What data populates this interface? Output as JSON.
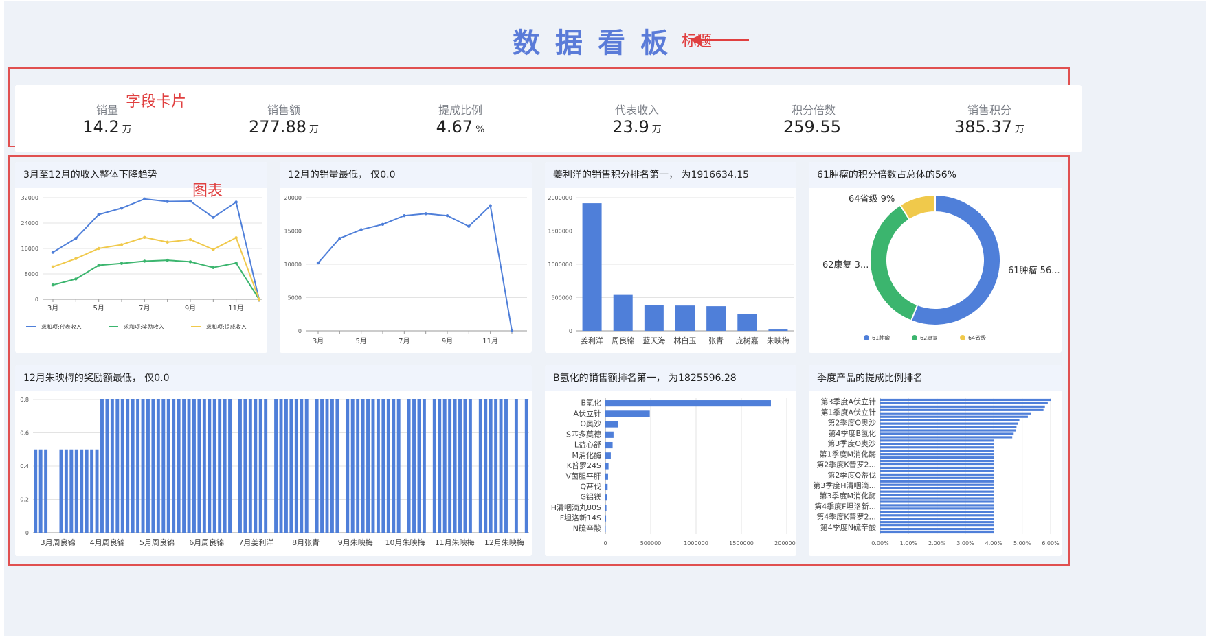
{
  "title": "数据看板",
  "annotations": {
    "title_label": "标题",
    "cards_label": "字段卡片",
    "charts_label": "图表"
  },
  "colors": {
    "accent": "#5a7bd8",
    "blue": "#4f7fd9",
    "green": "#3bb56e",
    "yellow": "#f0c94b",
    "annot": "#e04040"
  },
  "cards": [
    {
      "label": "销量",
      "value": "14.2",
      "unit": "万"
    },
    {
      "label": "销售额",
      "value": "277.88",
      "unit": "万"
    },
    {
      "label": "提成比例",
      "value": "4.67",
      "unit": "%"
    },
    {
      "label": "代表收入",
      "value": "23.9",
      "unit": "万"
    },
    {
      "label": "积分倍数",
      "value": "259.55",
      "unit": ""
    },
    {
      "label": "销售积分",
      "value": "385.37",
      "unit": "万"
    }
  ],
  "panels": {
    "p1": "3月至12月的收入整体下降趋势",
    "p2": "12月的销量最低， 仅0.0",
    "p3": "姜利洋的销售积分排名第一， 为1916634.15",
    "p4": "61肿瘤的积分倍数占总体的56%",
    "p5": "12月朱映梅的奖励额最低， 仅0.0",
    "p6": "B氢化的销售额排名第一， 为1825596.28",
    "p7": "季度产品的提成比例排名"
  },
  "chart_data": [
    {
      "type": "line",
      "x": [
        "3月",
        "4月",
        "5月",
        "6月",
        "7月",
        "8月",
        "9月",
        "10月",
        "11月",
        "12月"
      ],
      "x_ticks": [
        "3月",
        "5月",
        "7月",
        "9月",
        "11月"
      ],
      "ylim": [
        0,
        32000
      ],
      "y_ticks": [
        "0",
        "8000",
        "16000",
        "24000",
        "32000"
      ],
      "series": [
        {
          "name": "求和项:代表收入",
          "color": "#4f7fd9",
          "values": [
            14800,
            19200,
            26700,
            28700,
            31600,
            30800,
            30900,
            25800,
            30600,
            0
          ]
        },
        {
          "name": "求和项:奖励收入",
          "color": "#3bb56e",
          "values": [
            4500,
            6400,
            10700,
            11300,
            12000,
            12300,
            11800,
            10000,
            11400,
            0
          ]
        },
        {
          "name": "求和项:提成收入",
          "color": "#f0c94b",
          "values": [
            10200,
            12800,
            16000,
            17200,
            19500,
            18000,
            18800,
            15700,
            19400,
            0
          ]
        }
      ],
      "legend": "bottom"
    },
    {
      "type": "line",
      "x": [
        "3月",
        "4月",
        "5月",
        "6月",
        "7月",
        "8月",
        "9月",
        "10月",
        "11月",
        "12月"
      ],
      "x_ticks": [
        "3月",
        "5月",
        "7月",
        "9月",
        "11月"
      ],
      "ylim": [
        0,
        20000
      ],
      "y_ticks": [
        "0",
        "5000",
        "10000",
        "15000",
        "20000"
      ],
      "series": [
        {
          "color": "#4f7fd9",
          "values": [
            10200,
            13900,
            15200,
            16000,
            17300,
            17600,
            17300,
            15700,
            18800,
            0
          ]
        }
      ]
    },
    {
      "type": "bar",
      "categories": [
        "姜利洋",
        "周良锦",
        "蓝天海",
        "林白玉",
        "张青",
        "庞树嘉",
        "朱映梅"
      ],
      "values": [
        1916634,
        540000,
        390000,
        380000,
        370000,
        250000,
        20000
      ],
      "ylim": [
        0,
        2000000
      ],
      "y_ticks": [
        "0",
        "500000",
        "1000000",
        "1500000",
        "2000000"
      ]
    },
    {
      "type": "pie",
      "donut": true,
      "slices": [
        {
          "name": "61肿瘤",
          "value": 56,
          "label": "61肿瘤 56...",
          "color": "#4f7fd9"
        },
        {
          "name": "62康复",
          "value": 35,
          "label": "62康复 3...",
          "color": "#3bb56e"
        },
        {
          "name": "64省级",
          "value": 9,
          "label": "64省级 9%",
          "color": "#f0c94b"
        }
      ],
      "legend": "bottom"
    },
    {
      "type": "bar",
      "x_ticks": [
        "3月周良锦",
        "4月周良锦",
        "5月周良锦",
        "6月周良锦",
        "7月姜利洋",
        "8月张青",
        "9月朱映梅",
        "10月朱映梅",
        "11月朱映梅",
        "12月朱映梅"
      ],
      "ylim": [
        0,
        0.8
      ],
      "y_ticks": [
        "0",
        "0.2",
        "0.4",
        "0.6",
        "0.8"
      ],
      "values": [
        0.5,
        0.5,
        0.5,
        0,
        0,
        0.5,
        0.5,
        0.5,
        0.5,
        0.5,
        0.5,
        0.5,
        0.5,
        0.8,
        0.8,
        0.8,
        0.8,
        0.8,
        0.8,
        0.8,
        0.8,
        0.8,
        0.8,
        0.8,
        0.8,
        0.8,
        0.8,
        0.8,
        0.8,
        0.8,
        0.8,
        0.8,
        0.8,
        0.8,
        0.8,
        0.8,
        0.8,
        0.8,
        0.8,
        0,
        0.8,
        0.8,
        0.8,
        0.8,
        0.8,
        0.8,
        0,
        0.8,
        0.8,
        0.8,
        0.8,
        0.8,
        0.8,
        0.8,
        0,
        0.8,
        0.8,
        0.8,
        0.8,
        0.8,
        0,
        0.8,
        0.8,
        0.8,
        0.8,
        0.8,
        0.8,
        0.8,
        0.8,
        0.8,
        0.8,
        0.8,
        0,
        0.8,
        0.8,
        0.8,
        0.8,
        0,
        0.8,
        0.8,
        0.8,
        0.8,
        0.8,
        0.8,
        0.8,
        0.8,
        0,
        0.8,
        0.8,
        0.8,
        0.8,
        0.8,
        0.8,
        0,
        0.8,
        0,
        0.8
      ]
    },
    {
      "type": "bar",
      "orientation": "horizontal",
      "categories": [
        "B氢化",
        "A伏立针",
        "O奥沙",
        "S匹多莫德",
        "L益心舒",
        "M消化酶",
        "K普罗24S",
        "V茵胆平肝",
        "Q蒂伐",
        "G铝镁",
        "H清咽滴丸80S",
        "F坦洛新14S",
        "N硫辛酸"
      ],
      "values": [
        1825596,
        490000,
        140000,
        90000,
        80000,
        60000,
        35000,
        30000,
        25000,
        18000,
        12000,
        8000,
        4000
      ],
      "xlim": [
        0,
        2000000
      ],
      "x_ticks": [
        "0",
        "500000",
        "1000000",
        "1500000",
        "2000000"
      ]
    },
    {
      "type": "bar",
      "orientation": "horizontal",
      "categories": [
        "第3季度A伏立针",
        "第1季度A伏立针",
        "第2季度O奥沙",
        "第4季度B氢化",
        "第3季度O奥沙",
        "第1季度M消化酶",
        "第2季度K普罗2...",
        "第2季度Q蒂伐",
        "第3季度H清咽滴...",
        "第3季度M消化酶",
        "第4季度F坦洛新...",
        "第4季度K普罗2...",
        "第4季度N硫辛酸"
      ],
      "values": [
        0.06,
        0.059,
        0.058,
        0.0575,
        0.053,
        0.052,
        0.049,
        0.0485,
        0.048,
        0.0478,
        0.047,
        0.0465,
        0.04,
        0.04,
        0.04,
        0.04,
        0.04,
        0.04,
        0.04,
        0.04,
        0.04,
        0.04,
        0.04,
        0.04,
        0.04,
        0.04,
        0.04,
        0.04,
        0.04,
        0.04,
        0.04,
        0.04,
        0.04,
        0.04,
        0.04,
        0.04,
        0.04,
        0.04,
        0.04,
        0.04
      ],
      "xlim": [
        0,
        0.06
      ],
      "x_ticks": [
        "0.00%",
        "1.00%",
        "2.00%",
        "3.00%",
        "4.00%",
        "5.00%",
        "6.00%"
      ]
    }
  ]
}
